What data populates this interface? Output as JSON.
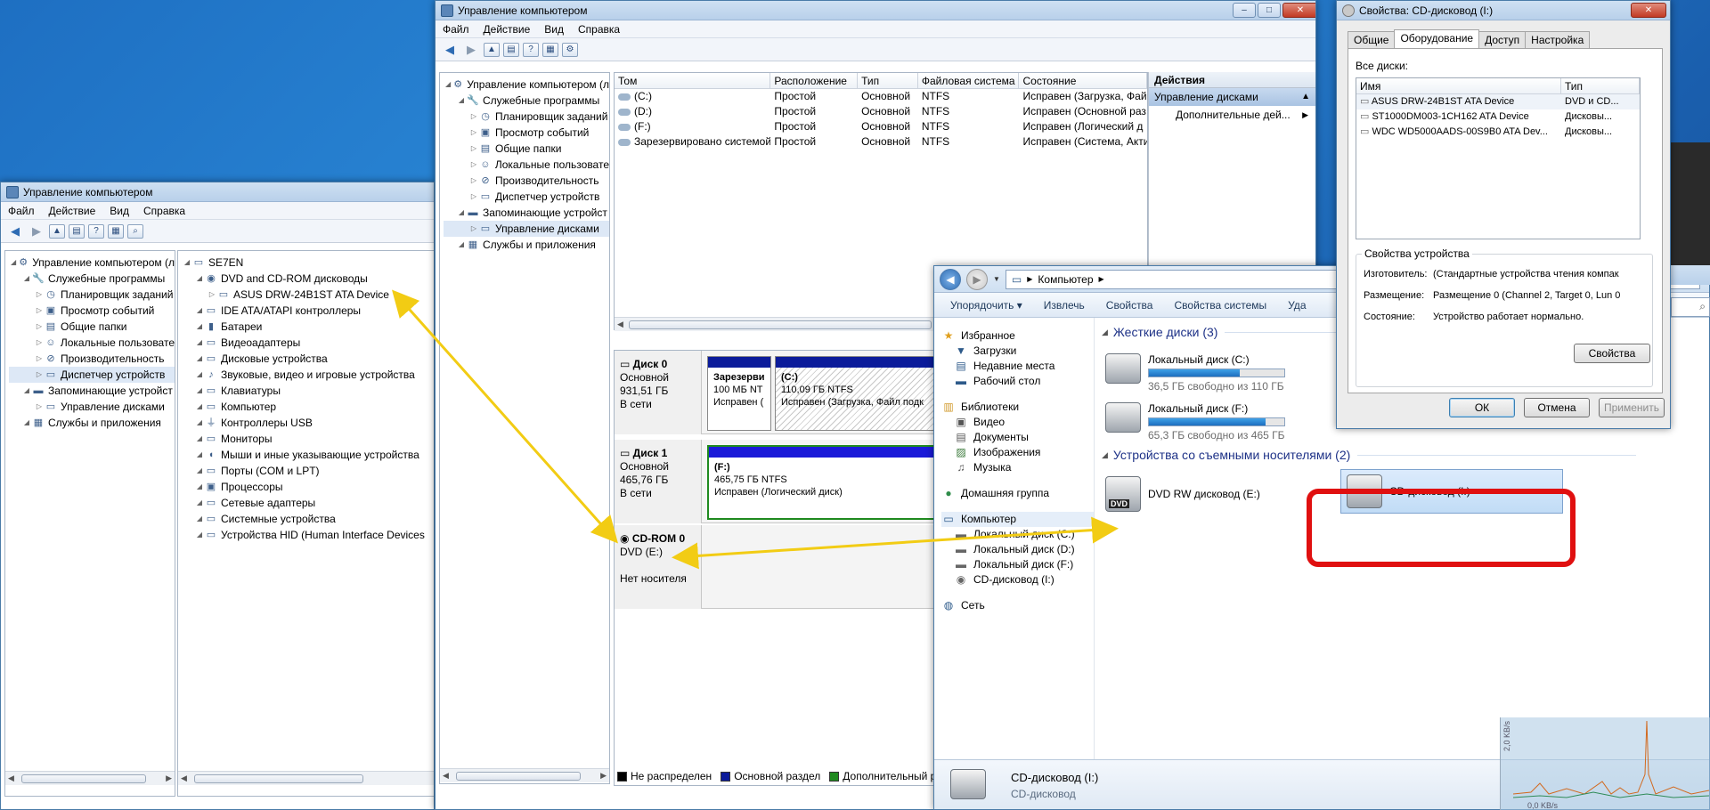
{
  "win1": {
    "title": "Управление компьютером",
    "menu": [
      "Файл",
      "Действие",
      "Вид",
      "Справка"
    ],
    "left_tree": [
      {
        "label": "Управление компьютером (л",
        "level": 0,
        "icon": "computer-management-icon",
        "glyph": "⚙"
      },
      {
        "label": "Служебные программы",
        "level": 1,
        "icon": "tools-icon",
        "glyph": "🔧"
      },
      {
        "label": "Планировщик заданий",
        "level": 2,
        "icon": "scheduler-icon",
        "glyph": "◷"
      },
      {
        "label": "Просмотр событий",
        "level": 2,
        "icon": "event-viewer-icon",
        "glyph": "▣"
      },
      {
        "label": "Общие папки",
        "level": 2,
        "icon": "shared-folder-icon",
        "glyph": "▤"
      },
      {
        "label": "Локальные пользовате",
        "level": 2,
        "icon": "users-icon",
        "glyph": "☺"
      },
      {
        "label": "Производительность",
        "level": 2,
        "icon": "performance-icon",
        "glyph": "⊘"
      },
      {
        "label": "Диспетчер устройств",
        "level": 2,
        "icon": "device-manager-icon",
        "glyph": "▭",
        "selected": true
      },
      {
        "label": "Запоминающие устройст",
        "level": 1,
        "icon": "storage-icon",
        "glyph": "▬"
      },
      {
        "label": "Управление дисками",
        "level": 2,
        "icon": "disk-management-icon",
        "glyph": "▭"
      },
      {
        "label": "Службы и приложения",
        "level": 1,
        "icon": "services-icon",
        "glyph": "▦"
      }
    ],
    "device_tree": [
      {
        "label": "SE7EN",
        "level": 0,
        "icon": "computer-icon",
        "glyph": "▭"
      },
      {
        "label": "DVD and CD-ROM дисководы",
        "level": 1,
        "icon": "dvd-drive-icon",
        "glyph": "◉"
      },
      {
        "label": "ASUS DRW-24B1ST ATA Device",
        "level": 2,
        "icon": "dvd-device-icon",
        "glyph": "▭"
      },
      {
        "label": "IDE ATA/ATAPI контроллеры",
        "level": 1,
        "icon": "ide-controller-icon",
        "glyph": "▭"
      },
      {
        "label": "Батареи",
        "level": 1,
        "icon": "battery-icon",
        "glyph": "▮"
      },
      {
        "label": "Видеоадаптеры",
        "level": 1,
        "icon": "video-adapter-icon",
        "glyph": "▭"
      },
      {
        "label": "Дисковые устройства",
        "level": 1,
        "icon": "disk-drive-icon",
        "glyph": "▭"
      },
      {
        "label": "Звуковые, видео и игровые устройства",
        "level": 1,
        "icon": "sound-icon",
        "glyph": "♪"
      },
      {
        "label": "Клавиатуры",
        "level": 1,
        "icon": "keyboard-icon",
        "glyph": "▭"
      },
      {
        "label": "Компьютер",
        "level": 1,
        "icon": "computer-icon",
        "glyph": "▭"
      },
      {
        "label": "Контроллеры USB",
        "level": 1,
        "icon": "usb-icon",
        "glyph": "⏚"
      },
      {
        "label": "Мониторы",
        "level": 1,
        "icon": "monitor-icon",
        "glyph": "▭"
      },
      {
        "label": "Мыши и иные указывающие устройства",
        "level": 1,
        "icon": "mouse-icon",
        "glyph": "◖"
      },
      {
        "label": "Порты (COM и LPT)",
        "level": 1,
        "icon": "port-icon",
        "glyph": "▭"
      },
      {
        "label": "Процессоры",
        "level": 1,
        "icon": "cpu-icon",
        "glyph": "▣"
      },
      {
        "label": "Сетевые адаптеры",
        "level": 1,
        "icon": "network-adapter-icon",
        "glyph": "▭"
      },
      {
        "label": "Системные устройства",
        "level": 1,
        "icon": "system-device-icon",
        "glyph": "▭"
      },
      {
        "label": "Устройства HID (Human Interface Devices",
        "level": 1,
        "icon": "hid-icon",
        "glyph": "▭"
      }
    ]
  },
  "win2": {
    "title": "Управление компьютером",
    "menu": [
      "Файл",
      "Действие",
      "Вид",
      "Справка"
    ],
    "tree": [
      {
        "label": "Управление компьютером (л",
        "level": 0,
        "icon": "computer-management-icon",
        "glyph": "⚙"
      },
      {
        "label": "Служебные программы",
        "level": 1,
        "icon": "tools-icon",
        "glyph": "🔧"
      },
      {
        "label": "Планировщик заданий",
        "level": 2,
        "icon": "scheduler-icon",
        "glyph": "◷"
      },
      {
        "label": "Просмотр событий",
        "level": 2,
        "icon": "event-viewer-icon",
        "glyph": "▣"
      },
      {
        "label": "Общие папки",
        "level": 2,
        "icon": "shared-folder-icon",
        "glyph": "▤"
      },
      {
        "label": "Локальные пользовате",
        "level": 2,
        "icon": "users-icon",
        "glyph": "☺"
      },
      {
        "label": "Производительность",
        "level": 2,
        "icon": "performance-icon",
        "glyph": "⊘"
      },
      {
        "label": "Диспетчер устройств",
        "level": 2,
        "icon": "device-manager-icon",
        "glyph": "▭"
      },
      {
        "label": "Запоминающие устройст",
        "level": 1,
        "icon": "storage-icon",
        "glyph": "▬"
      },
      {
        "label": "Управление дисками",
        "level": 2,
        "icon": "disk-management-icon",
        "glyph": "▭",
        "selected": true
      },
      {
        "label": "Службы и приложения",
        "level": 1,
        "icon": "services-icon",
        "glyph": "▦"
      }
    ],
    "volume_columns": [
      "Том",
      "Расположение",
      "Тип",
      "Файловая система",
      "Состояние"
    ],
    "volumes": [
      [
        "(C:)",
        "Простой",
        "Основной",
        "NTFS",
        "Исправен (Загрузка, Фай"
      ],
      [
        "(D:)",
        "Простой",
        "Основной",
        "NTFS",
        "Исправен (Основной раз"
      ],
      [
        "(F:)",
        "Простой",
        "Основной",
        "NTFS",
        "Исправен (Логический д"
      ],
      [
        "Зарезервировано системой",
        "Простой",
        "Основной",
        "NTFS",
        "Исправен (Система, Акти"
      ]
    ],
    "disks": [
      {
        "name": "Диск 0",
        "lines": [
          "Основной",
          "931,51 ГБ",
          "В сети"
        ]
      },
      {
        "name": "Диск 1",
        "lines": [
          "Основной",
          "465,76 ГБ",
          "В сети"
        ]
      },
      {
        "name": "CD-ROM 0",
        "lines": [
          "DVD (E:)",
          "",
          "Нет носителя"
        ]
      }
    ],
    "partitions": {
      "reserved": {
        "title": "Зарезерви",
        "size": "100 МБ NT",
        "status": "Исправен ("
      },
      "c": {
        "title": "(C:)",
        "size": "110,09 ГБ NTFS",
        "status": "Исправен (Загрузка, Файл подк"
      },
      "f": {
        "title": "(F:)",
        "size": "465,75 ГБ NTFS",
        "status": "Исправен (Логический диск)"
      }
    },
    "legend": [
      "Не распределен",
      "Основной раздел",
      "Дополнительный ра"
    ],
    "legend_colors": [
      "#000000",
      "#0b1b9a",
      "#1f8a1f"
    ],
    "actions": {
      "header": "Действия",
      "section": "Управление дисками",
      "more": "Дополнительные дей..."
    }
  },
  "explorer": {
    "address": "Компьютер",
    "commands": [
      "Упорядочить ▾",
      "Извлечь",
      "Свойства",
      "Свойства системы",
      "Уда"
    ],
    "nav": [
      {
        "label": "Избранное",
        "level": 0,
        "icon": "star-icon",
        "glyph": "★",
        "color": "#e0a020"
      },
      {
        "label": "Загрузки",
        "level": 1,
        "icon": "downloads-icon",
        "glyph": "▼",
        "color": "#2d5a8a"
      },
      {
        "label": "Недавние места",
        "level": 1,
        "icon": "recent-places-icon",
        "glyph": "▤",
        "color": "#2d5a8a"
      },
      {
        "label": "Рабочий стол",
        "level": 1,
        "icon": "desktop-icon",
        "glyph": "▬",
        "color": "#2d5a8a"
      },
      {
        "label": "",
        "level": 0,
        "icon": "",
        "glyph": "",
        "color": ""
      },
      {
        "label": "Библиотеки",
        "level": 0,
        "icon": "libraries-icon",
        "glyph": "▥",
        "color": "#d29b2f"
      },
      {
        "label": "Видео",
        "level": 1,
        "icon": "video-icon",
        "glyph": "▣",
        "color": "#555"
      },
      {
        "label": "Документы",
        "level": 1,
        "icon": "documents-icon",
        "glyph": "▤",
        "color": "#555"
      },
      {
        "label": "Изображения",
        "level": 1,
        "icon": "pictures-icon",
        "glyph": "▨",
        "color": "#3b7a3b"
      },
      {
        "label": "Музыка",
        "level": 1,
        "icon": "music-icon",
        "glyph": "♫",
        "color": "#555"
      },
      {
        "label": "",
        "level": 0,
        "icon": "",
        "glyph": "",
        "color": ""
      },
      {
        "label": "Домашняя группа",
        "level": 0,
        "icon": "homegroup-icon",
        "glyph": "●",
        "color": "#2f8c4a"
      },
      {
        "label": "",
        "level": 0,
        "icon": "",
        "glyph": "",
        "color": ""
      },
      {
        "label": "Компьютер",
        "level": 0,
        "icon": "computer-icon",
        "glyph": "▭",
        "color": "#2d5a8a",
        "selected": true
      },
      {
        "label": "Локальный диск (C:)",
        "level": 1,
        "icon": "local-disk-icon",
        "glyph": "▬",
        "color": "#666"
      },
      {
        "label": "Локальный диск (D:)",
        "level": 1,
        "icon": "local-disk-icon",
        "glyph": "▬",
        "color": "#666"
      },
      {
        "label": "Локальный диск (F:)",
        "level": 1,
        "icon": "local-disk-icon",
        "glyph": "▬",
        "color": "#666"
      },
      {
        "label": "CD-дисковод (I:)",
        "level": 1,
        "icon": "cd-drive-icon",
        "glyph": "◉",
        "color": "#666"
      },
      {
        "label": "",
        "level": 0,
        "icon": "",
        "glyph": "",
        "color": ""
      },
      {
        "label": "Сеть",
        "level": 0,
        "icon": "network-icon",
        "glyph": "◍",
        "color": "#2d5a8a"
      }
    ],
    "hdd_group": "Жесткие диски (3)",
    "drives": [
      {
        "name": "Локальный диск (C:)",
        "free": "36,5 ГБ свободно из 110 ГБ",
        "used_fraction": 0.67
      },
      {
        "name": "Локальный диск (F:)",
        "free": "65,3 ГБ свободно из 465 ГБ",
        "used_fraction": 0.86
      }
    ],
    "removable_group": "Устройства со съемными носителями (2)",
    "dvd_label": "DVD RW дисковод (E:)",
    "dvd_badge": "DVD",
    "cd_label": "CD-дисковод (I:)",
    "status_title": "CD-дисковод (I:)",
    "status_sub": "CD-дисковод"
  },
  "props": {
    "title": "Свойства: CD-дисковод (I:)",
    "tabs": [
      "Общие",
      "Оборудование",
      "Доступ",
      "Настройка"
    ],
    "all_disks_label": "Все диски:",
    "columns": [
      "Имя",
      "Тип"
    ],
    "disks": [
      [
        "ASUS DRW-24B1ST ATA Device",
        "DVD и CD..."
      ],
      [
        "ST1000DM003-1CH162 ATA Device",
        "Дисковы..."
      ],
      [
        "WDC WD5000AADS-00S9B0 ATA Dev...",
        "Дисковы..."
      ]
    ],
    "group_title": "Свойства устройства",
    "props": [
      [
        "Изготовитель:",
        "(Стандартные устройства чтения компак"
      ],
      [
        "Размещение:",
        "Размещение 0 (Channel 2, Target 0, Lun 0"
      ],
      [
        "Состояние:",
        "Устройство работает нормально."
      ]
    ],
    "properties_button": "Свойства",
    "ok": "ОК",
    "cancel": "Отмена",
    "apply": "Применить"
  },
  "net_gadget": {
    "axis_label": "2,0 KB/s",
    "bottom_text": "0,0 KB/s"
  },
  "colors": {
    "highlight": "#e01010",
    "arrow": "#f2cc14"
  }
}
